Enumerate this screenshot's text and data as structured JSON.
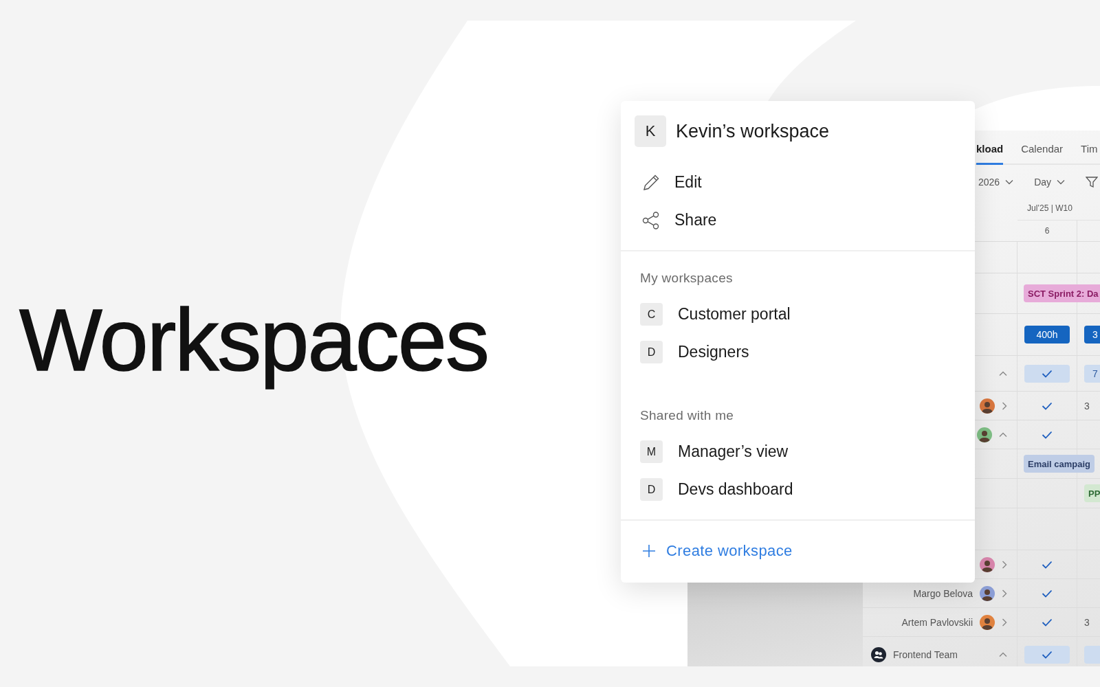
{
  "headline": "Workspaces",
  "menu": {
    "current": {
      "initial": "K",
      "name": "Kevin’s workspace"
    },
    "actions": [
      {
        "kind": "edit",
        "label": "Edit"
      },
      {
        "kind": "share",
        "label": "Share"
      }
    ],
    "sections": [
      {
        "title": "My workspaces",
        "items": [
          {
            "initial": "C",
            "name": "Customer portal"
          },
          {
            "initial": "D",
            "name": "Designers"
          }
        ]
      },
      {
        "title": "Shared with me",
        "items": [
          {
            "initial": "M",
            "name": "Manager’s view"
          },
          {
            "initial": "D",
            "name": "Devs dashboard"
          }
        ]
      }
    ],
    "create": "Create workspace"
  },
  "app": {
    "tabs": [
      {
        "label": "kload",
        "selected": true
      },
      {
        "label": "Calendar",
        "selected": false
      },
      {
        "label": "Tim",
        "selected": false
      }
    ],
    "toolbar": {
      "period": "2026",
      "scale": "Day"
    },
    "week": "Jul’25 | W10",
    "day": "6",
    "rows": [
      {
        "kind": "blank"
      },
      {
        "kind": "event",
        "cells": [
          {
            "kind": "chip",
            "text": "SCT Sprint 2: Da",
            "color": "#e7abd9"
          }
        ]
      },
      {
        "kind": "capacity",
        "cells": [
          {
            "kind": "chip",
            "text": "400h",
            "color": "#1565c0"
          },
          {
            "kind": "chip",
            "text": "3",
            "color": "#1565c0"
          }
        ]
      },
      {
        "kind": "group",
        "expanded": true,
        "cells": [
          {
            "kind": "check",
            "color": "#cddcf0"
          },
          {
            "kind": "chip",
            "text": "7",
            "color": "#cddcf0"
          }
        ]
      },
      {
        "kind": "person",
        "color": "#d9773f",
        "expanded": false,
        "cells": [
          {
            "kind": "check"
          },
          {
            "kind": "text",
            "text": "3"
          }
        ]
      },
      {
        "kind": "person",
        "color": "#7fbf85",
        "expanded": true,
        "cells": [
          {
            "kind": "check"
          }
        ]
      },
      {
        "kind": "task",
        "cells": [
          {
            "kind": "chip",
            "text": "Email campaig",
            "color": "#bfcde6"
          }
        ]
      },
      {
        "kind": "task",
        "cells": [
          {
            "kind": "empty"
          },
          {
            "kind": "chip",
            "text": "PP",
            "color": "#d3e8d1"
          }
        ]
      },
      {
        "kind": "gap"
      },
      {
        "kind": "person",
        "color": "#d986ad",
        "expanded": false,
        "cells": [
          {
            "kind": "check"
          }
        ]
      },
      {
        "kind": "person",
        "name": "Margo Belova",
        "color": "#8d9fd6",
        "expanded": false,
        "cells": [
          {
            "kind": "check"
          }
        ]
      },
      {
        "kind": "person",
        "name": "Artem Pavlovskii",
        "color": "#e0823f",
        "expanded": false,
        "cells": [
          {
            "kind": "check"
          },
          {
            "kind": "text",
            "text": "3"
          }
        ]
      },
      {
        "kind": "team",
        "name": "Frontend Team",
        "expanded": true,
        "cells": [
          {
            "kind": "check",
            "color": "#cddcf0"
          },
          {
            "kind": "chip",
            "color": "#cddcf0"
          }
        ]
      }
    ]
  }
}
